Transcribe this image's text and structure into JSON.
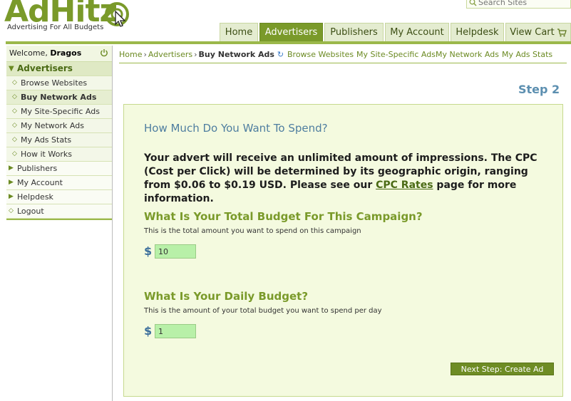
{
  "brand": {
    "name_part1": "AdHitz",
    "tagline": "Advertising For All Budgets"
  },
  "search": {
    "placeholder": "Search Sites"
  },
  "nav": {
    "tabs": [
      {
        "label": "Home",
        "active": false
      },
      {
        "label": "Advertisers",
        "active": true
      },
      {
        "label": "Publishers",
        "active": false
      },
      {
        "label": "My Account",
        "active": false
      },
      {
        "label": "Helpdesk",
        "active": false
      },
      {
        "label": "View Cart",
        "active": false,
        "icon": "cart-icon"
      }
    ]
  },
  "sidebar": {
    "welcome_prefix": "Welcome,",
    "username": "Dragos",
    "items": [
      {
        "label": "Advertisers",
        "level": "head"
      },
      {
        "label": "Browse Websites",
        "level": "sub"
      },
      {
        "label": "Buy Network Ads",
        "level": "sub",
        "active": true
      },
      {
        "label": "My Site-Specific Ads",
        "level": "sub"
      },
      {
        "label": "My Network Ads",
        "level": "sub"
      },
      {
        "label": "My Ads Stats",
        "level": "sub"
      },
      {
        "label": "How it Works",
        "level": "sub"
      },
      {
        "label": "Publishers",
        "level": "top"
      },
      {
        "label": "My Account",
        "level": "top"
      },
      {
        "label": "Helpdesk",
        "level": "top"
      },
      {
        "label": "Logout",
        "level": "top"
      }
    ]
  },
  "breadcrumb": {
    "home": "Home",
    "advertisers": "Advertisers",
    "current": "Buy Network Ads"
  },
  "quick_links": [
    "Browse Websites",
    "My Site-Specific Ads",
    "My Network Ads",
    "My Ads Stats"
  ],
  "step_label": "Step 2",
  "form": {
    "heading": "How Much Do You Want To Spend?",
    "desc_before": "Your advert will receive an unlimited amount of impressions. The CPC (Cost per Click) will be determined by its geographic origin, ranging from $0.06 to $0.19 USD. Please see our ",
    "desc_link": "CPC Rates",
    "desc_after": " page for more information.",
    "total_budget": {
      "question": "What Is Your Total Budget For This Campaign?",
      "hint": "This is the total amount you want to spend on this campaign",
      "currency": "$",
      "value": "10"
    },
    "daily_budget": {
      "question": "What Is Your Daily Budget?",
      "hint": "This is the amount of your total budget you want to spend per day",
      "currency": "$",
      "value": "1"
    },
    "next_button": "Next Step: Create Ad"
  },
  "colors": {
    "brand_green": "#7a9a2a",
    "panel_bg": "#f4fadf",
    "input_bg": "#b8f0a8",
    "heading_blue": "#4f7ea0"
  }
}
